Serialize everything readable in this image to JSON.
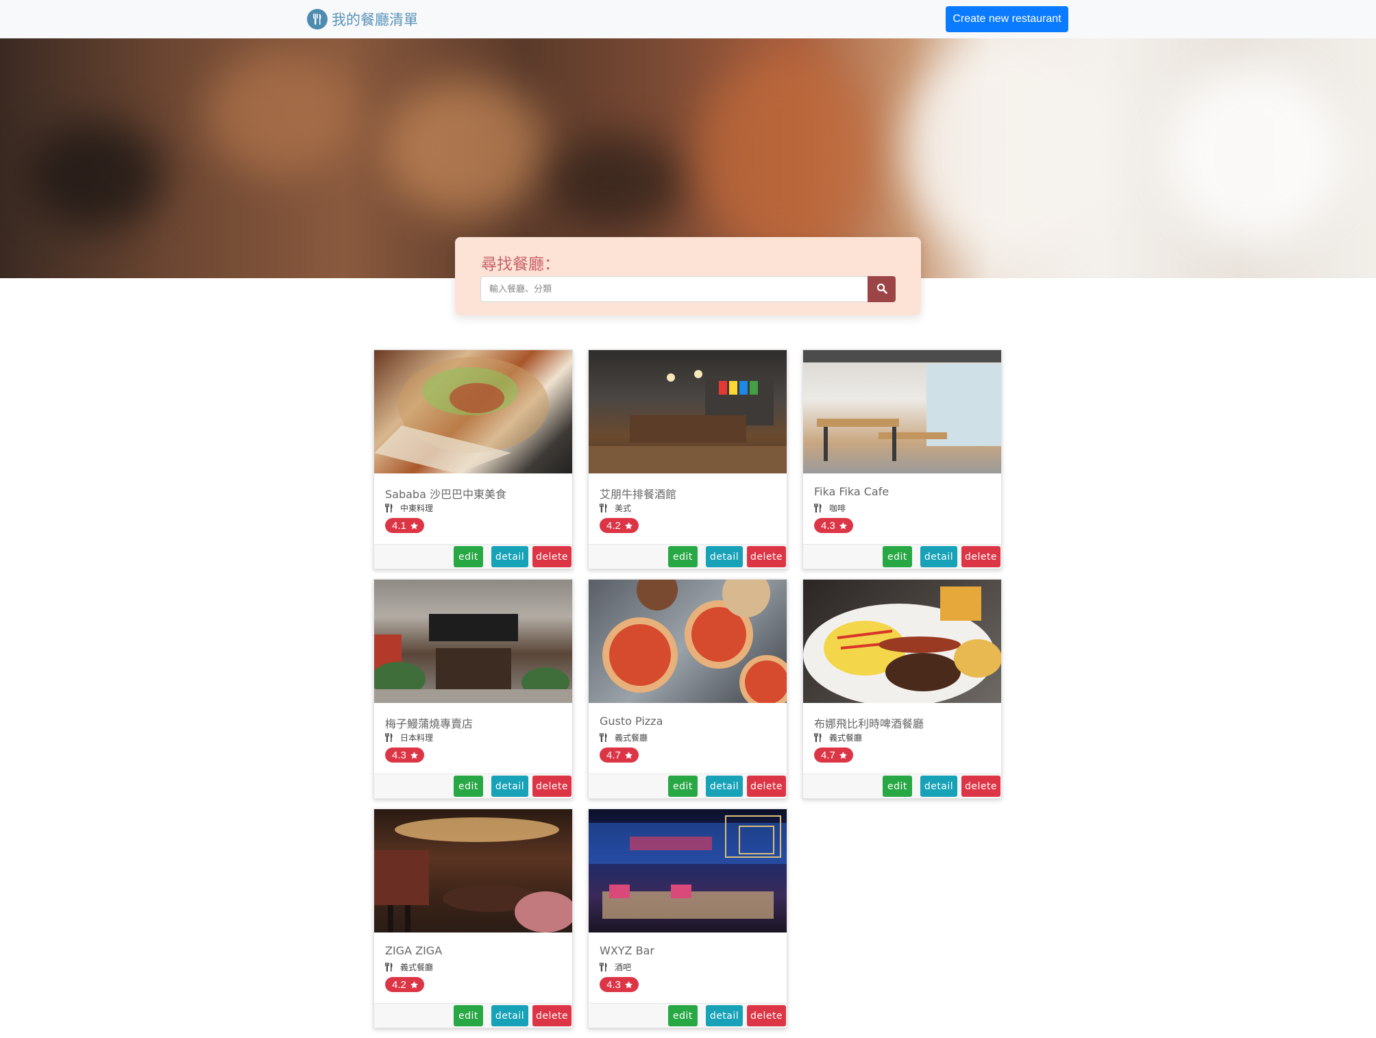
{
  "navbar": {
    "brand": "我的餐廳清單",
    "create_button": "Create new restaurant"
  },
  "search": {
    "title": "尋找餐廳：",
    "placeholder": "輸入餐廳、分類"
  },
  "card_buttons": {
    "edit": "edit",
    "detail": "detail",
    "delete": "delete"
  },
  "restaurants": [
    {
      "name": "Sababa 沙巴巴中東美食",
      "category": "中東料理",
      "rating": "4.1"
    },
    {
      "name": "艾朋牛排餐酒館",
      "category": "美式",
      "rating": "4.2"
    },
    {
      "name": "Fika Fika Cafe",
      "category": "咖啡",
      "rating": "4.3"
    },
    {
      "name": "梅子鰻蒲燒專賣店",
      "category": "日本料理",
      "rating": "4.3"
    },
    {
      "name": "Gusto Pizza",
      "category": "義式餐廳",
      "rating": "4.7"
    },
    {
      "name": "布娜飛比利時啤酒餐廳",
      "category": "義式餐廳",
      "rating": "4.7"
    },
    {
      "name": "ZIGA ZIGA",
      "category": "義式餐廳",
      "rating": "4.2"
    },
    {
      "name": "WXYZ Bar",
      "category": "酒吧",
      "rating": "4.3"
    }
  ],
  "colors": {
    "primary": "#0a7bff",
    "success": "#28a745",
    "info": "#17a2b8",
    "danger": "#dc3545",
    "search_bg": "#fde3d5",
    "search_btn": "#9b4547"
  }
}
